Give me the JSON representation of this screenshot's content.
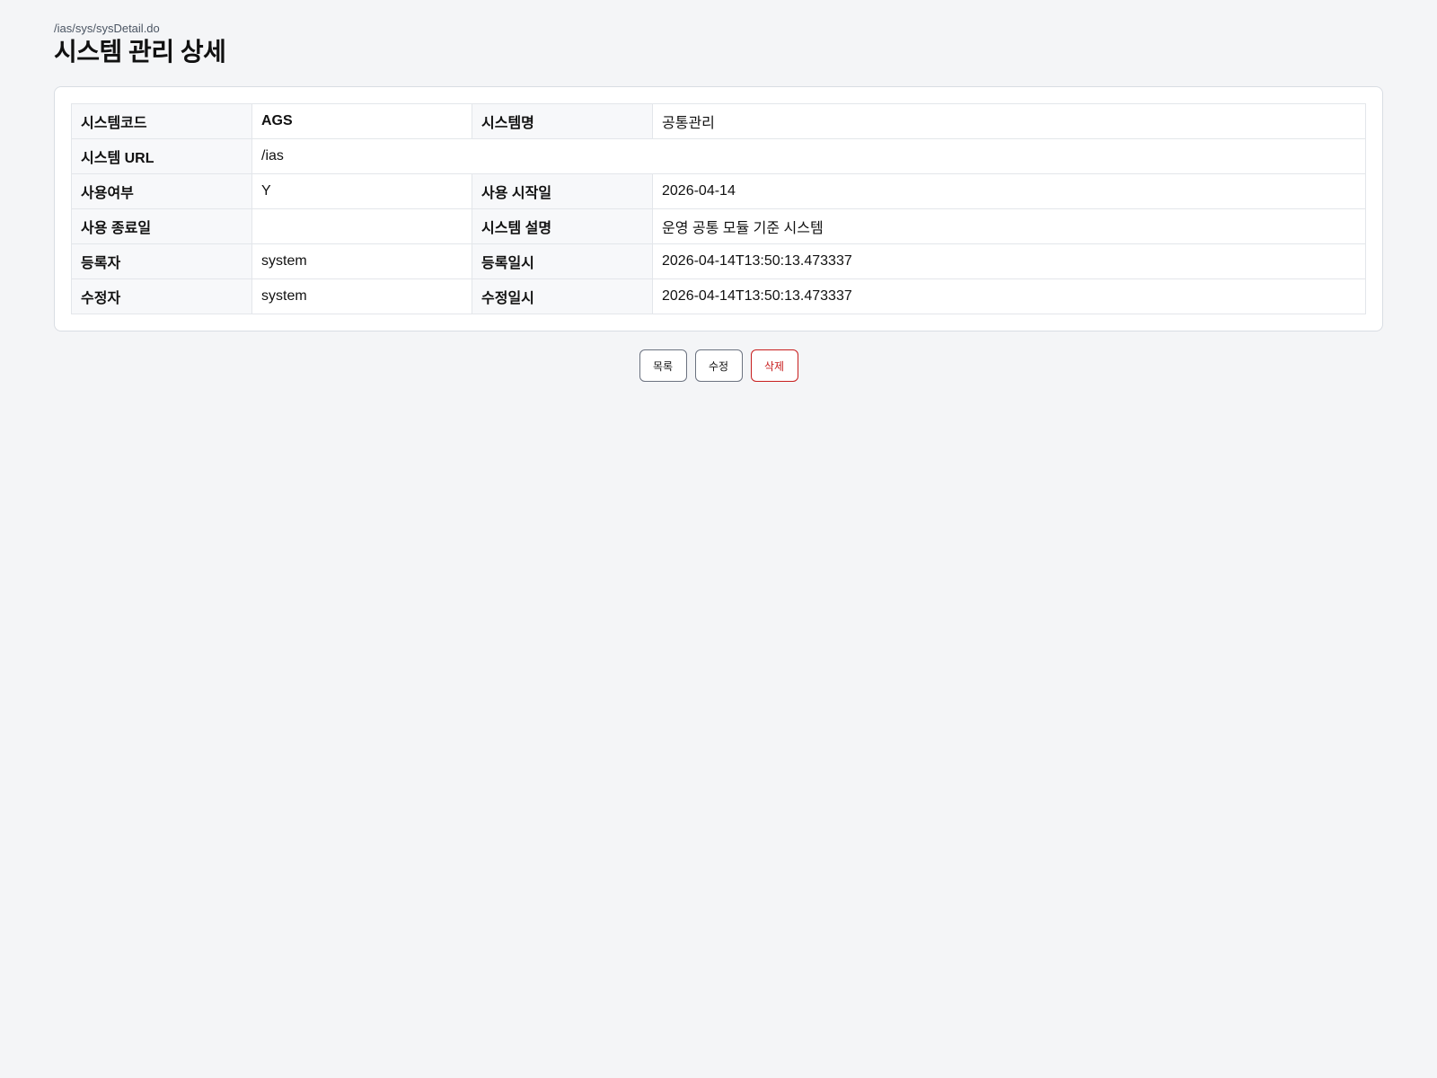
{
  "header": {
    "path": "/ias/sys/sysDetail.do",
    "title": "시스템 관리 상세"
  },
  "detail": {
    "system_code_label": "시스템코드",
    "system_code_value": "AGS",
    "system_name_label": "시스템명",
    "system_name_value": "공통관리",
    "system_url_label": "시스템 URL",
    "system_url_value": "/ias",
    "use_yn_label": "사용여부",
    "use_yn_value": "Y",
    "use_start_label": "사용 시작일",
    "use_start_value": "2026-04-14",
    "use_end_label": "사용 종료일",
    "use_end_value": "",
    "system_desc_label": "시스템 설명",
    "system_desc_value": "운영 공통 모듈 기준 시스템",
    "registrant_label": "등록자",
    "registrant_value": "system",
    "registered_at_label": "등록일시",
    "registered_at_value": "2026-04-14T13:50:13.473337",
    "modifier_label": "수정자",
    "modifier_value": "system",
    "modified_at_label": "수정일시",
    "modified_at_value": "2026-04-14T13:50:13.473337"
  },
  "actions": {
    "list_label": "목록",
    "edit_label": "수정",
    "delete_label": "삭제"
  },
  "colors": {
    "background": "#f4f5f7",
    "danger": "#c81e1e"
  }
}
